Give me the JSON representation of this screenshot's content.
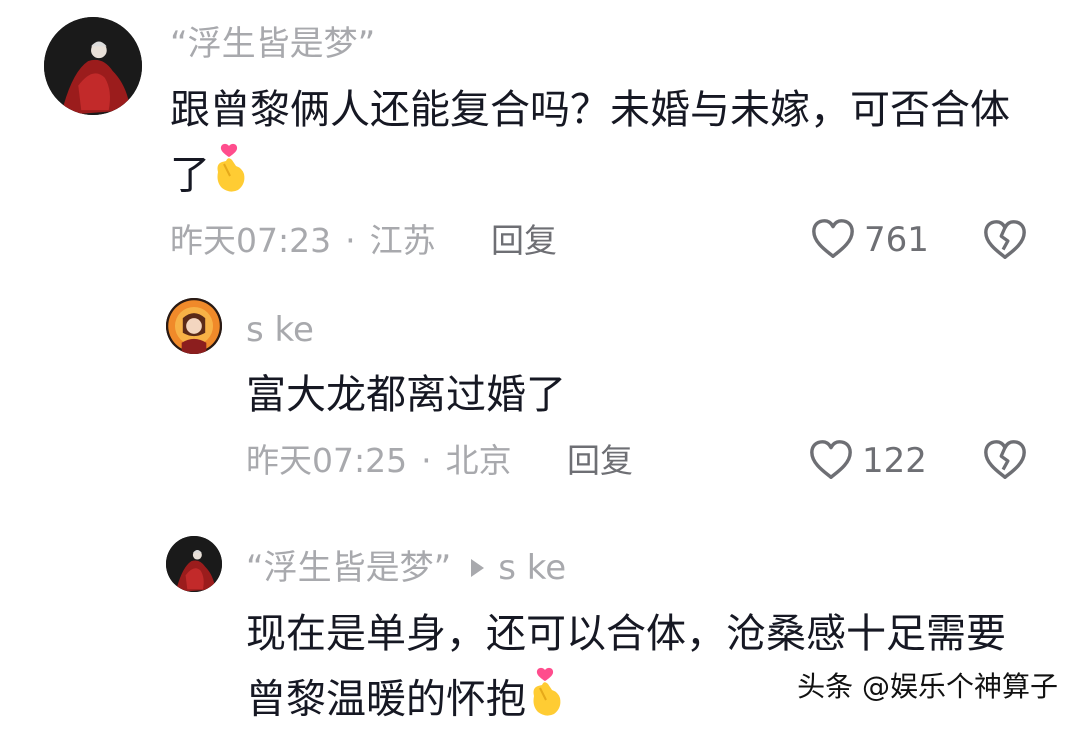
{
  "comments": [
    {
      "username": "“浮生皆是梦”",
      "text_line1": "跟曾黎俩人还能复合吗？未婚与未嫁，可否合体",
      "text_line2": "了",
      "emoji": "finger-heart",
      "time": "昨天07:23",
      "location": "江苏",
      "reply_label": "回复",
      "likes": "761"
    },
    {
      "username": "s ke",
      "text_line1": "富大龙都离过婚了",
      "time": "昨天07:25",
      "location": "北京",
      "reply_label": "回复",
      "likes": "122"
    },
    {
      "username": "“浮生皆是梦”",
      "reply_to": "s ke",
      "text_line1": "现在是单身，还可以合体，沧桑感十足需要",
      "text_line2": "曾黎温暖的怀抱",
      "emoji": "finger-heart"
    }
  ],
  "separator": "·",
  "watermark": "头条 @娱乐个神算子",
  "colors": {
    "text": "#161823",
    "secondary": "#a8a9ad",
    "icon": "#6e6f74",
    "heart_pink": "#ff4d8d",
    "hand_yellow": "#ffcc33"
  }
}
